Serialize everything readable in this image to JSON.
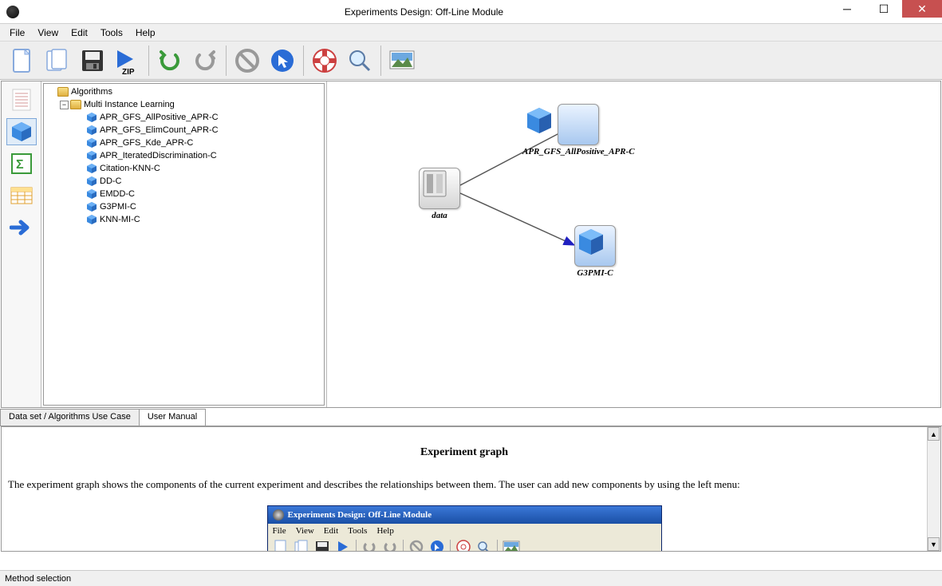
{
  "title": "Experiments Design: Off-Line Module",
  "menu": {
    "file": "File",
    "view": "View",
    "edit": "Edit",
    "tools": "Tools",
    "help": "Help"
  },
  "tree": {
    "root": "Algorithms",
    "group": "Multi Instance Learning",
    "leaves": [
      "APR_GFS_AllPositive_APR-C",
      "APR_GFS_ElimCount_APR-C",
      "APR_GFS_Kde_APR-C",
      "APR_IteratedDiscrimination-C",
      "Citation-KNN-C",
      "DD-C",
      "EMDD-C",
      "G3PMI-C",
      "KNN-MI-C"
    ]
  },
  "graph": {
    "node_data": "data",
    "node_a": "APR_GFS_AllPositive_APR-C",
    "node_b": "G3PMI-C"
  },
  "tabs": {
    "t1": "Data set / Algorithms Use Case",
    "t2": "User Manual"
  },
  "manual": {
    "title": "Experiment graph",
    "body": "The experiment graph shows the components of the current experiment and describes the relationships between them. The user can add new components by using the left menu:",
    "shot_title": "Experiments Design: Off-Line Module",
    "shot_menu": {
      "file": "File",
      "view": "View",
      "edit": "Edit",
      "tools": "Tools",
      "help": "Help"
    }
  },
  "status": "Method selection"
}
